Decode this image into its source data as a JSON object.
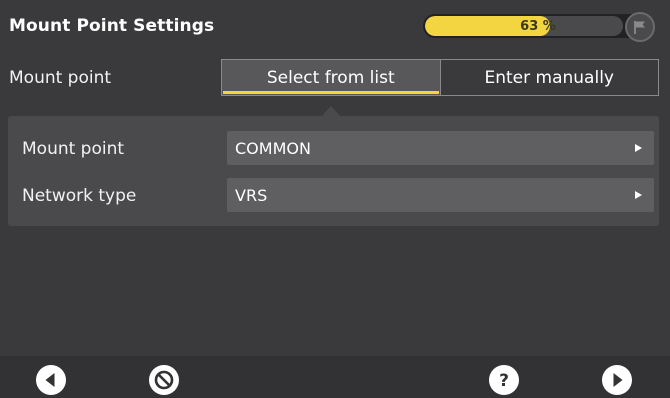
{
  "header": {
    "title": "Mount Point Settings",
    "progress_label": "63 %",
    "progress_fraction": 0.63
  },
  "mount_point_row": {
    "label": "Mount point",
    "tabs": [
      {
        "label": "Select from list",
        "active": true
      },
      {
        "label": "Enter manually",
        "active": false
      }
    ]
  },
  "panel": {
    "fields": [
      {
        "label": "Mount point",
        "value": "COMMON"
      },
      {
        "label": "Network type",
        "value": "VRS"
      }
    ]
  },
  "footer": {
    "icons": [
      "back-icon",
      "cancel-icon",
      "help-icon",
      "next-icon"
    ]
  },
  "colors": {
    "accent": "#f2d541",
    "background": "#3a3a3c",
    "panel": "#4a4a4c",
    "field": "#5f5f61"
  }
}
